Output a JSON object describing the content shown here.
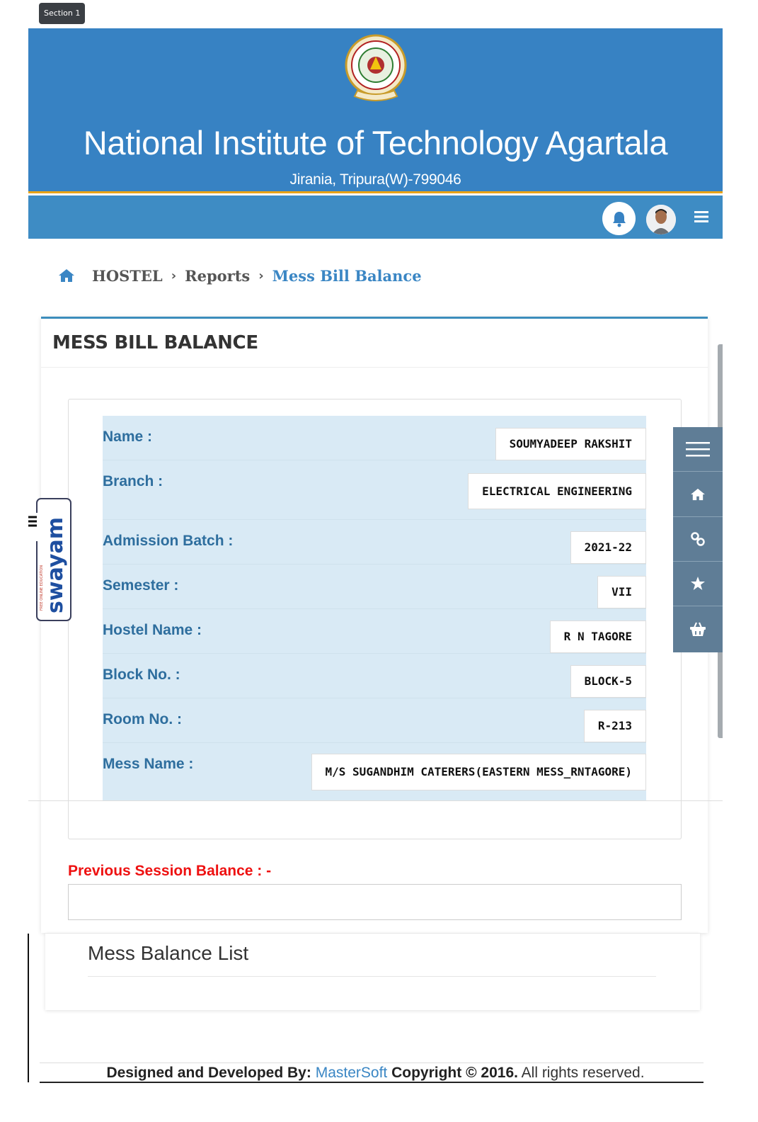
{
  "section_tag": "Section 1",
  "header": {
    "title": "National Institute of Technology Agartala",
    "subtitle": "Jirania, Tripura(W)-799046"
  },
  "breadcrumb": {
    "items": [
      "HOSTEL",
      "Reports",
      "Mess Bill Balance"
    ]
  },
  "panel": {
    "title": "MESS BILL BALANCE"
  },
  "student": {
    "rows": [
      {
        "label": "Name :",
        "value": "SOUMYADEEP RAKSHIT"
      },
      {
        "label": "Branch :",
        "value": "ELECTRICAL ENGINEERING"
      },
      {
        "label": "Admission Batch :",
        "value": "2021-22"
      },
      {
        "label": "Semester :",
        "value": "VII"
      },
      {
        "label": "Hostel Name :",
        "value": "R N TAGORE"
      },
      {
        "label": "Block No. :",
        "value": "BLOCK-5"
      },
      {
        "label": "Room No. :",
        "value": "R-213"
      },
      {
        "label": "Mess Name :",
        "value": "M/S SUGANDHIM CATERERS(EASTERN MESS_RNTAGORE)"
      }
    ]
  },
  "previous_balance": {
    "label": "Previous Session Balance : -",
    "value": ""
  },
  "mess_list": {
    "title": "Mess Balance List"
  },
  "swayam": {
    "brand": "swayam",
    "tagline": "FREE ONLINE EDUCATION"
  },
  "footer": {
    "prefix": "Designed and Developed By:",
    "company": "MasterSoft",
    "copyright": "Copyright",
    "symbol_year": "© 2016.",
    "rights": "All rights reserved."
  },
  "colors": {
    "header_blue": "#3782c3",
    "navbar_blue": "#3e8cc4",
    "accent_gold": "#e8a317",
    "table_bg": "#d9eaf5",
    "label_blue": "#2e6e9e",
    "alert_red": "#ee1111",
    "toolbar_gray": "#5f7d96"
  },
  "icons": [
    "bell-icon",
    "avatar",
    "hamburger-menu-icon",
    "home-icon",
    "chevron-right-icon",
    "link-icon",
    "star-icon",
    "basket-icon"
  ]
}
